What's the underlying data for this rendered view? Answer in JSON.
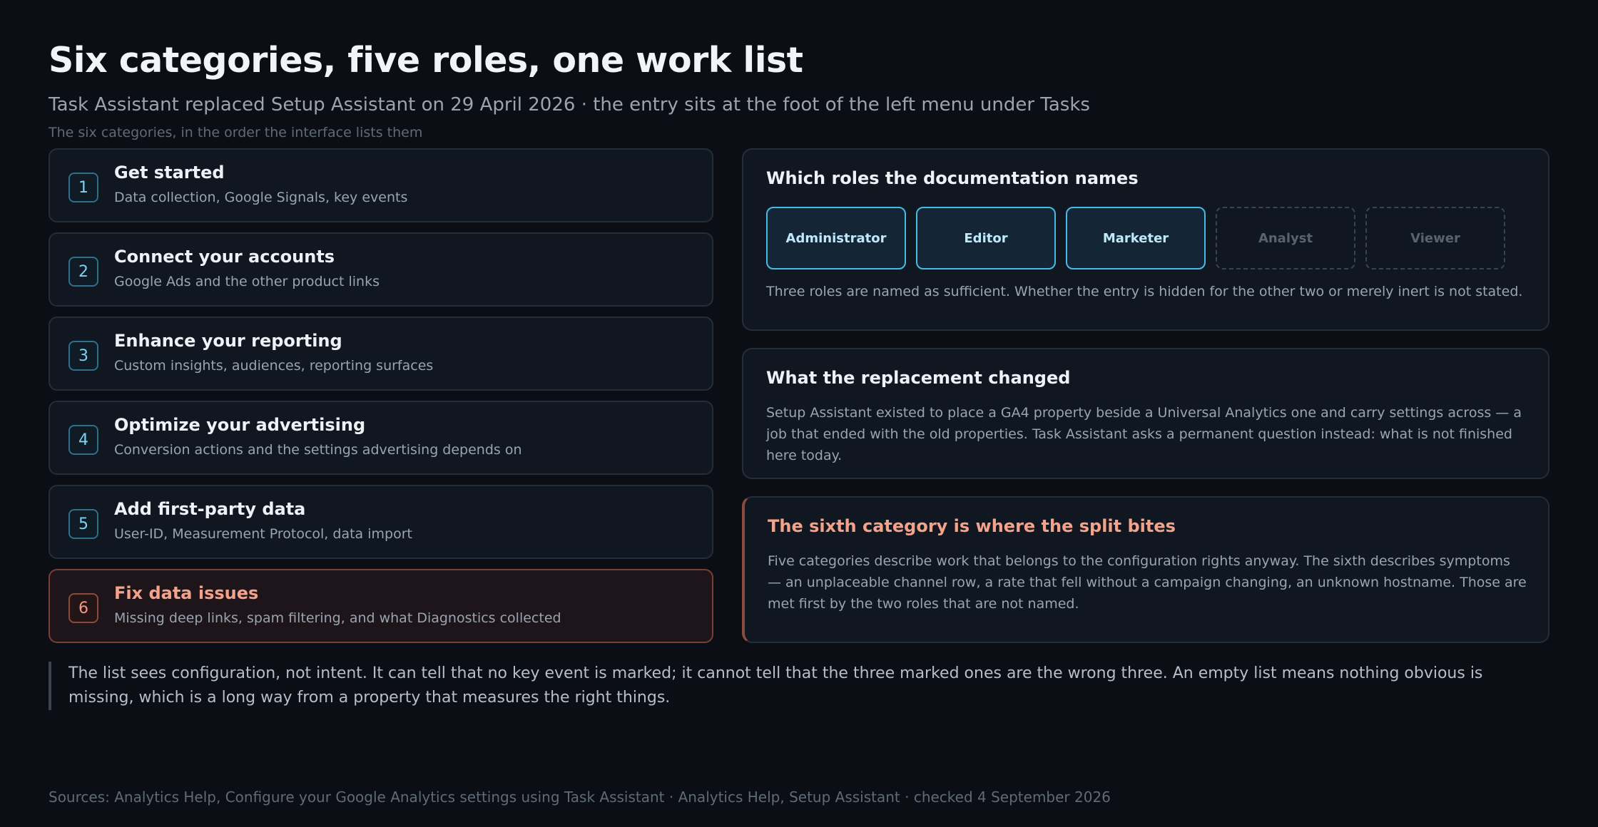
{
  "header": {
    "title": "Six categories, five roles, one work list",
    "subtitle": "Task Assistant replaced Setup Assistant on 29 April 2026 · the entry sits at the foot of the left menu under Tasks",
    "section_label": "The six categories, in the order the interface lists them"
  },
  "categories": [
    {
      "num": "1",
      "title": "Get started",
      "desc": "Data collection, Google Signals, key events"
    },
    {
      "num": "2",
      "title": "Connect your accounts",
      "desc": "Google Ads and the other product links"
    },
    {
      "num": "3",
      "title": "Enhance your reporting",
      "desc": "Custom insights, audiences, reporting surfaces"
    },
    {
      "num": "4",
      "title": "Optimize your advertising",
      "desc": "Conversion actions and the settings advertising depends on"
    },
    {
      "num": "5",
      "title": "Add first-party data",
      "desc": "User-ID, Measurement Protocol, data import"
    },
    {
      "num": "6",
      "title": "Fix data issues",
      "desc": "Missing deep links, spam filtering, and what Diagnostics collected"
    }
  ],
  "roles_panel": {
    "title": "Which roles the documentation names",
    "roles": [
      "Administrator",
      "Editor",
      "Marketer",
      "Analyst",
      "Viewer"
    ],
    "note": "Three roles are named as sufficient. Whether the entry is hidden for the other two or merely inert is not stated."
  },
  "change_panel": {
    "title": "What the replacement changed",
    "body": "Setup Assistant existed to place a GA4 property beside a Universal Analytics one and carry settings across — a job that ended with the old properties. Task Assistant asks a permanent question instead: what is not finished here today."
  },
  "sixth_panel": {
    "title": "The sixth category is where the split bites",
    "body": "Five categories describe work that belongs to the configuration rights anyway. The sixth describes symptoms — an unplaceable channel row, a rate that fell without a campaign changing, an unknown hostname. Those are met first by the two roles that are not named."
  },
  "quote": "The list sees configuration, not intent. It can tell that no key event is marked; it cannot tell that the three marked ones are the wrong three. An empty list means nothing obvious is missing, which is a long way from a property that measures the right things.",
  "sources": "Sources: Analytics Help, Configure your Google Analytics settings using Task Assistant · Analytics Help, Setup Assistant · checked 4 September 2026"
}
